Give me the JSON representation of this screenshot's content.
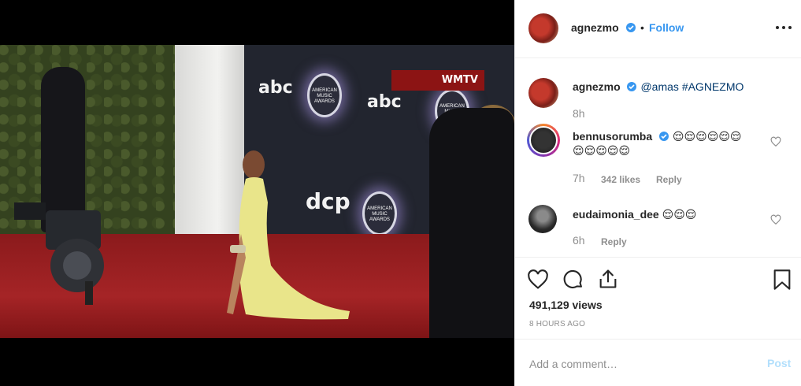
{
  "post": {
    "author": "agnezmo",
    "follow_label": "Follow",
    "separator": "•",
    "caption_author": "agnezmo",
    "caption_mention": "@amas",
    "caption_hashtag": "#AGNEZMO",
    "caption_time": "8h",
    "views": "491,129 views",
    "posted_ago": "8 HOURS AGO"
  },
  "video": {
    "backdrop_logos": [
      "abc",
      "abc",
      "dcp",
      "abc",
      "dcp"
    ],
    "award_badge": "AMERICAN MUSIC AWARDS",
    "banner": "WMTV"
  },
  "comments": [
    {
      "username": "bennusorumba",
      "verified": true,
      "text_line1": "😌😌😌😌😌😌",
      "text_line2": "😌😌😌😌😌",
      "time": "7h",
      "likes": "342 likes",
      "reply_label": "Reply"
    },
    {
      "username": "eudaimonia_dee",
      "verified": false,
      "text_line1": "😌😌😌",
      "time": "6h",
      "reply_label": "Reply"
    }
  ],
  "add_comment": {
    "placeholder": "Add a comment…",
    "post_label": "Post"
  },
  "colors": {
    "link": "#3897f0",
    "post_disabled": "#b2dffc",
    "muted": "#8e8e8e",
    "carpet": "#a52426"
  }
}
